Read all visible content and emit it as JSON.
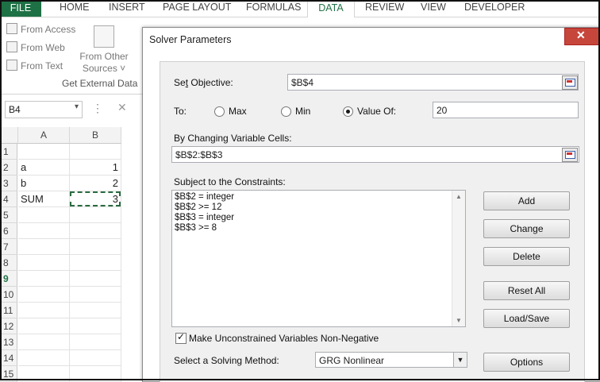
{
  "ribbon": {
    "tabs": [
      "FILE",
      "HOME",
      "INSERT",
      "PAGE LAYOUT",
      "FORMULAS",
      "DATA",
      "REVIEW",
      "VIEW",
      "DEVELOPER"
    ],
    "external": {
      "from_access": "From Access",
      "from_web": "From Web",
      "from_text": "From Text",
      "from_other_line1": "From Other",
      "from_other_line2": "Sources ˅",
      "group_label": "Get External Data"
    }
  },
  "formula_bar": {
    "name_box": "B4",
    "cancel_icon": "✕",
    "dots": "⋮"
  },
  "sheet": {
    "columns": [
      "A",
      "B"
    ],
    "rows": [
      "1",
      "2",
      "3",
      "4",
      "5",
      "6",
      "7",
      "8",
      "9",
      "10",
      "11",
      "12",
      "13",
      "14",
      "15"
    ],
    "cells": [
      {
        "row": 2,
        "a": "a",
        "b": "1"
      },
      {
        "row": 3,
        "a": "b",
        "b": "2"
      },
      {
        "row": 4,
        "a": "SUM",
        "b": "3"
      }
    ],
    "selected_cell": "B4"
  },
  "solver": {
    "title": "Solver Parameters",
    "set_objective_label_u": "t",
    "set_objective_label_pre": "Se",
    "set_objective_label_post": " Objective:",
    "objective_value": "$B$4",
    "to_label": "To:",
    "max_label": "Max",
    "min_label": "Min",
    "value_of_label": "Value Of:",
    "to_selected": "Value Of",
    "value_of": "20",
    "changing_label": "By Changing Variable Cells:",
    "changing_value": "$B$2:$B$3",
    "constraints_label": "Subject to the Constraints:",
    "constraints": [
      "$B$2 = integer",
      "$B$2 >= 12",
      "$B$3 = integer",
      "$B$3 >= 8"
    ],
    "buttons": {
      "add": "Add",
      "change": "Change",
      "delete": "Delete",
      "reset_all": "Reset All",
      "load_save": "Load/Save",
      "options": "Options"
    },
    "nonneg_label": "Make Unconstrained Variables Non-Negative",
    "nonneg_checked": true,
    "method_label": "Select a Solving Method:",
    "method_value": "GRG Nonlinear"
  },
  "colors": {
    "excel_green": "#217346",
    "close_red": "#c7463b"
  }
}
